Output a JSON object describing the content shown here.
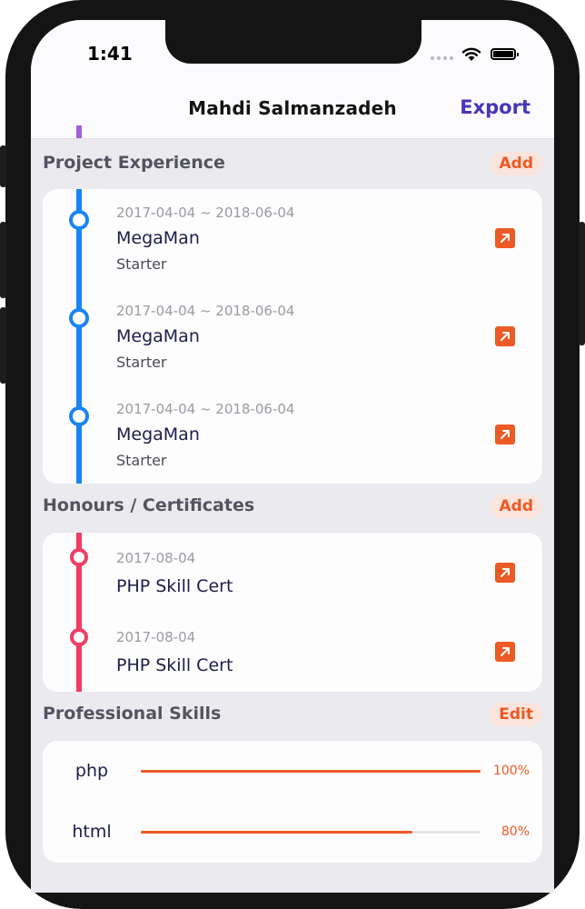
{
  "status_bar": {
    "time": "1:41"
  },
  "navbar": {
    "title": "Mahdi Salmanzadeh",
    "export_label": "Export"
  },
  "colors": {
    "accent": "#ec5a25",
    "nav_action": "#4536b8",
    "project_timeline": "#1a84f4",
    "honours_timeline": "#f23b63",
    "previous_timeline": "#a060d8"
  },
  "project_experience": {
    "title": "Project Experience",
    "add_label": "Add",
    "items": [
      {
        "date": "2017-04-04 ~ 2018-06-04",
        "name": "MegaMan",
        "role": "Starter",
        "icon": "external-link-icon"
      },
      {
        "date": "2017-04-04 ~ 2018-06-04",
        "name": "MegaMan",
        "role": "Starter",
        "icon": "external-link-icon"
      },
      {
        "date": "2017-04-04 ~ 2018-06-04",
        "name": "MegaMan",
        "role": "Starter",
        "icon": "external-link-icon"
      }
    ]
  },
  "honours": {
    "title": "Honours / Certificates",
    "add_label": "Add",
    "items": [
      {
        "date": "2017-08-04",
        "name": "PHP Skill Cert",
        "icon": "external-link-icon"
      },
      {
        "date": "2017-08-04",
        "name": "PHP Skill Cert",
        "icon": "external-link-icon"
      }
    ]
  },
  "skills": {
    "title": "Professional Skills",
    "edit_label": "Edit",
    "items": [
      {
        "name": "php",
        "level": 1.0,
        "percent_label": "100%"
      },
      {
        "name": "html",
        "level": 0.8,
        "percent_label": "80%"
      }
    ]
  }
}
